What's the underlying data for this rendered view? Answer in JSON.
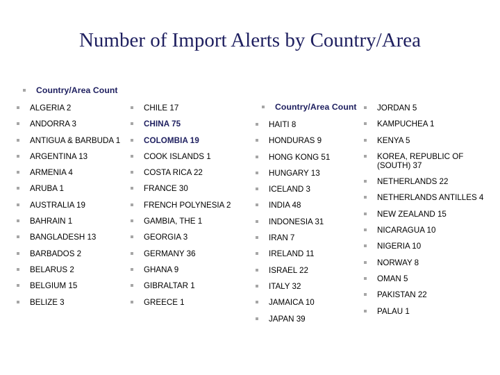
{
  "slide": {
    "title": "Number of Import Alerts by Country/Area",
    "title_color": "#1f2060",
    "background_color": "#ffffff",
    "bullet_color": "#a6a6a6",
    "highlight_color": "#1f2060",
    "body_text_color": "#000000"
  },
  "columns": [
    {
      "header": "Country/Area Count",
      "items": [
        {
          "text": "ALGERIA 2",
          "country": "ALGERIA",
          "count": 2,
          "highlight": false
        },
        {
          "text": "ANDORRA 3",
          "country": "ANDORRA",
          "count": 3,
          "highlight": false
        },
        {
          "text": "ANTIGUA & BARBUDA 1",
          "country": "ANTIGUA & BARBUDA",
          "count": 1,
          "highlight": false
        },
        {
          "text": "ARGENTINA 13",
          "country": "ARGENTINA",
          "count": 13,
          "highlight": false
        },
        {
          "text": "ARMENIA 4",
          "country": "ARMENIA",
          "count": 4,
          "highlight": false
        },
        {
          "text": "ARUBA 1",
          "country": "ARUBA",
          "count": 1,
          "highlight": false
        },
        {
          "text": "AUSTRALIA 19",
          "country": "AUSTRALIA",
          "count": 19,
          "highlight": false
        },
        {
          "text": "BAHRAIN 1",
          "country": "BAHRAIN",
          "count": 1,
          "highlight": false
        },
        {
          "text": "BANGLADESH 13",
          "country": "BANGLADESH",
          "count": 13,
          "highlight": false
        },
        {
          "text": "BARBADOS 2",
          "country": "BARBADOS",
          "count": 2,
          "highlight": false
        },
        {
          "text": "BELARUS 2",
          "country": "BELARUS",
          "count": 2,
          "highlight": false
        },
        {
          "text": "BELGIUM 15",
          "country": "BELGIUM",
          "count": 15,
          "highlight": false
        },
        {
          "text": "BELIZE 3",
          "country": "BELIZE",
          "count": 3,
          "highlight": false
        }
      ]
    },
    {
      "header": null,
      "items": [
        {
          "text": "CHILE 17",
          "country": "CHILE",
          "count": 17,
          "highlight": false
        },
        {
          "text": "CHINA 75",
          "country": "CHINA",
          "count": 75,
          "highlight": true
        },
        {
          "text": "COLOMBIA 19",
          "country": "COLOMBIA",
          "count": 19,
          "highlight": true
        },
        {
          "text": "COOK ISLANDS 1",
          "country": "COOK ISLANDS",
          "count": 1,
          "highlight": false
        },
        {
          "text": "COSTA RICA 22",
          "country": "COSTA RICA",
          "count": 22,
          "highlight": false
        },
        {
          "text": "FRANCE 30",
          "country": "FRANCE",
          "count": 30,
          "highlight": false
        },
        {
          "text": "FRENCH POLYNESIA 2",
          "country": "FRENCH POLYNESIA",
          "count": 2,
          "highlight": false
        },
        {
          "text": "GAMBIA, THE 1",
          "country": "GAMBIA, THE",
          "count": 1,
          "highlight": false
        },
        {
          "text": "GEORGIA 3",
          "country": "GEORGIA",
          "count": 3,
          "highlight": false
        },
        {
          "text": "GERMANY 36",
          "country": "GERMANY",
          "count": 36,
          "highlight": false
        },
        {
          "text": "GHANA 9",
          "country": "GHANA",
          "count": 9,
          "highlight": false
        },
        {
          "text": "GIBRALTAR 1",
          "country": "GIBRALTAR",
          "count": 1,
          "highlight": false
        },
        {
          "text": "GREECE 1",
          "country": "GREECE",
          "count": 1,
          "highlight": false
        }
      ]
    },
    {
      "header": "Country/Area Count",
      "items": [
        {
          "text": "HAITI 8",
          "country": "HAITI",
          "count": 8,
          "highlight": false
        },
        {
          "text": "HONDURAS 9",
          "country": "HONDURAS",
          "count": 9,
          "highlight": false
        },
        {
          "text": "HONG KONG 51",
          "country": "HONG KONG",
          "count": 51,
          "highlight": false
        },
        {
          "text": "HUNGARY 13",
          "country": "HUNGARY",
          "count": 13,
          "highlight": false
        },
        {
          "text": "ICELAND 3",
          "country": "ICELAND",
          "count": 3,
          "highlight": false
        },
        {
          "text": "INDIA 48",
          "country": "INDIA",
          "count": 48,
          "highlight": false
        },
        {
          "text": "INDONESIA 31",
          "country": "INDONESIA",
          "count": 31,
          "highlight": false
        },
        {
          "text": "IRAN 7",
          "country": "IRAN",
          "count": 7,
          "highlight": false
        },
        {
          "text": "IRELAND 11",
          "country": "IRELAND",
          "count": 11,
          "highlight": false
        },
        {
          "text": "ISRAEL 22",
          "country": "ISRAEL",
          "count": 22,
          "highlight": false
        },
        {
          "text": "ITALY 32",
          "country": "ITALY",
          "count": 32,
          "highlight": false
        },
        {
          "text": "JAMAICA 10",
          "country": "JAMAICA",
          "count": 10,
          "highlight": false
        },
        {
          "text": "JAPAN 39",
          "country": "JAPAN",
          "count": 39,
          "highlight": false
        }
      ]
    },
    {
      "header": null,
      "items": [
        {
          "text": "JORDAN 5",
          "country": "JORDAN",
          "count": 5,
          "highlight": false
        },
        {
          "text": "KAMPUCHEA 1",
          "country": "KAMPUCHEA",
          "count": 1,
          "highlight": false
        },
        {
          "text": "KENYA 5",
          "country": "KENYA",
          "count": 5,
          "highlight": false
        },
        {
          "text": "KOREA, REPUBLIC OF (SOUTH) 37",
          "country": "KOREA, REPUBLIC OF (SOUTH)",
          "count": 37,
          "highlight": false
        },
        {
          "text": "NETHERLANDS 22",
          "country": "NETHERLANDS",
          "count": 22,
          "highlight": false
        },
        {
          "text": "NETHERLANDS ANTILLES 4",
          "country": "NETHERLANDS ANTILLES",
          "count": 4,
          "highlight": false
        },
        {
          "text": "NEW ZEALAND 15",
          "country": "NEW ZEALAND",
          "count": 15,
          "highlight": false
        },
        {
          "text": "NICARAGUA 10",
          "country": "NICARAGUA",
          "count": 10,
          "highlight": false
        },
        {
          "text": "NIGERIA 10",
          "country": "NIGERIA",
          "count": 10,
          "highlight": false
        },
        {
          "text": "NORWAY 8",
          "country": "NORWAY",
          "count": 8,
          "highlight": false
        },
        {
          "text": "OMAN 5",
          "country": "OMAN",
          "count": 5,
          "highlight": false
        },
        {
          "text": "PAKISTAN 22",
          "country": "PAKISTAN",
          "count": 22,
          "highlight": false
        },
        {
          "text": "PALAU 1",
          "country": "PALAU",
          "count": 1,
          "highlight": false
        }
      ]
    }
  ]
}
